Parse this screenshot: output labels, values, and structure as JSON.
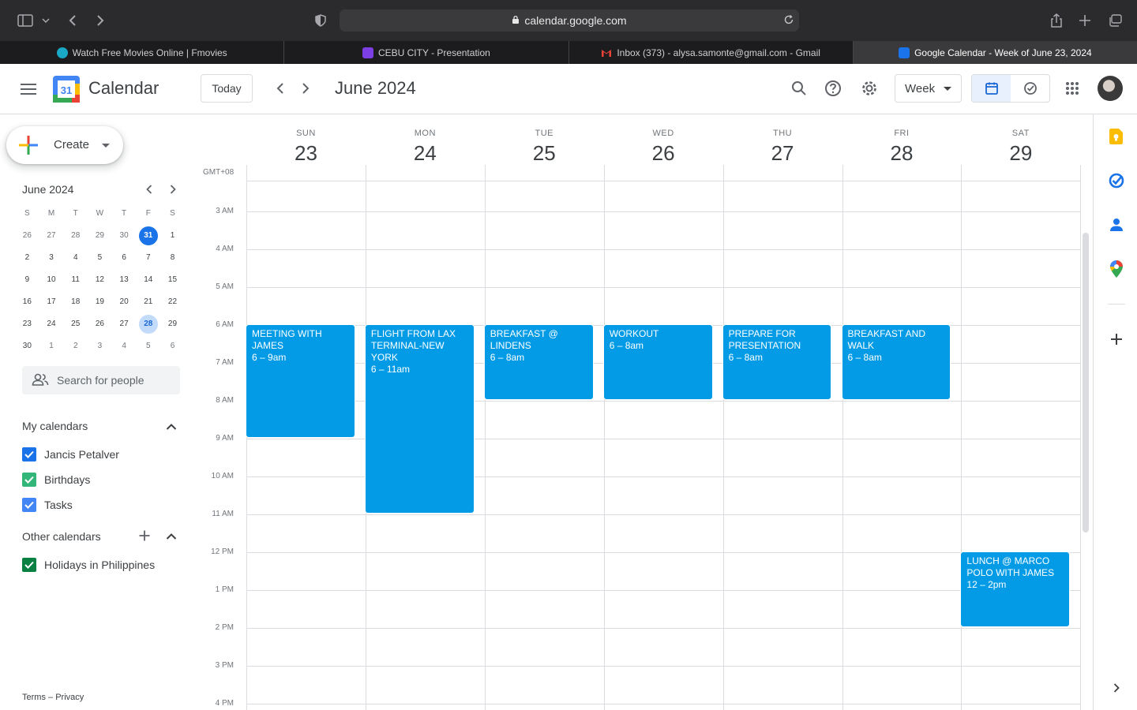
{
  "browser": {
    "url": "calendar.google.com",
    "tabs": [
      {
        "title": "Watch Free Movies Online | Fmovies",
        "favicon_color": "#19a8c5"
      },
      {
        "title": "CEBU CITY - Presentation",
        "favicon_color": "#7b3fe4"
      },
      {
        "title": "Inbox (373) - alysa.samonte@gmail.com - Gmail",
        "favicon_color": "#ea4335"
      },
      {
        "title": "Google Calendar - Week of June 23, 2024",
        "favicon_color": "#1a73e8"
      }
    ]
  },
  "header": {
    "app_title": "Calendar",
    "logo_text": "31",
    "today_label": "Today",
    "month_title": "June 2024",
    "view_label": "Week"
  },
  "sidebar": {
    "create_label": "Create",
    "mini_calendar": {
      "title": "June 2024",
      "weekdays": [
        "S",
        "M",
        "T",
        "W",
        "T",
        "F",
        "S"
      ],
      "weeks": [
        [
          "26",
          "27",
          "28",
          "29",
          "30",
          "31",
          "1"
        ],
        [
          "2",
          "3",
          "4",
          "5",
          "6",
          "7",
          "8"
        ],
        [
          "9",
          "10",
          "11",
          "12",
          "13",
          "14",
          "15"
        ],
        [
          "16",
          "17",
          "18",
          "19",
          "20",
          "21",
          "22"
        ],
        [
          "23",
          "24",
          "25",
          "26",
          "27",
          "28",
          "29"
        ],
        [
          "30",
          "1",
          "2",
          "3",
          "4",
          "5",
          "6"
        ]
      ]
    },
    "search_people_placeholder": "Search for people",
    "my_calendars_title": "My calendars",
    "my_calendars": [
      {
        "name": "Jancis Petalver",
        "color": "#1a73e8"
      },
      {
        "name": "Birthdays",
        "color": "#0b8043"
      },
      {
        "name": "Tasks",
        "color": "#4285f4"
      }
    ],
    "other_calendars_title": "Other calendars",
    "other_calendars": [
      {
        "name": "Holidays in Philippines",
        "color": "#0b8043"
      }
    ],
    "terms_label": "Terms",
    "privacy_label": "Privacy",
    "terms_sep": "–"
  },
  "week": {
    "timezone": "GMT+08",
    "days": [
      {
        "name": "SUN",
        "date": "23"
      },
      {
        "name": "MON",
        "date": "24"
      },
      {
        "name": "TUE",
        "date": "25"
      },
      {
        "name": "WED",
        "date": "26"
      },
      {
        "name": "THU",
        "date": "27"
      },
      {
        "name": "FRI",
        "date": "28"
      },
      {
        "name": "SAT",
        "date": "29"
      }
    ],
    "hours": [
      "3 AM",
      "4 AM",
      "5 AM",
      "6 AM",
      "7 AM",
      "8 AM",
      "9 AM",
      "10 AM",
      "11 AM",
      "12 PM",
      "1 PM",
      "2 PM",
      "3 PM",
      "4 PM"
    ],
    "events": [
      {
        "title": "MEETING WITH JAMES",
        "time": "6 – 9am"
      },
      {
        "title": "FLIGHT FROM LAX TERMINAL-NEW YORK",
        "time": "6 – 11am"
      },
      {
        "title": "BREAKFAST @ LINDENS",
        "time": "6 – 8am"
      },
      {
        "title": "WORKOUT",
        "time": "6 – 8am"
      },
      {
        "title": "PREPARE FOR PRESENTATION",
        "time": "6 – 8am"
      },
      {
        "title": "BREAKFAST AND WALK",
        "time": "6 – 8am"
      },
      {
        "title": "LUNCH @ MARCO POLO WITH JAMES",
        "time": "12 – 2pm"
      }
    ]
  },
  "colors": {
    "event": "#039be5",
    "accent": "#1a73e8"
  }
}
